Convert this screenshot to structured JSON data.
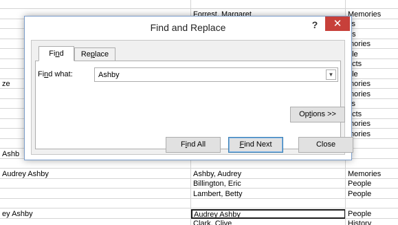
{
  "sheet": {
    "col_a": [
      "",
      "",
      "",
      "",
      "",
      "",
      "",
      "",
      "",
      "",
      "",
      "",
      "",
      "",
      "",
      "",
      "",
      "",
      "",
      "",
      "",
      "",
      ""
    ],
    "col_a_visible": [
      {
        "row": 8,
        "text": "ze"
      },
      {
        "row": 15,
        "text": "Ashb"
      },
      {
        "row": 17,
        "text": "Audrey Ashby"
      },
      {
        "row": 21,
        "text": "ey Ashby"
      }
    ],
    "col_b": [
      "",
      "Forrest, Margaret",
      "",
      "",
      "",
      "",
      "",
      "",
      "",
      "",
      "",
      "",
      "",
      "",
      "",
      "",
      "",
      "Ashby, Audrey",
      "Billington, Eric",
      "Lambert, Betty",
      "",
      "Audrey Ashby",
      "Clark, Clive"
    ],
    "col_c": [
      "",
      "Memories",
      "ks",
      "es",
      "mories",
      "ple",
      "ects",
      "ple",
      "mories",
      "mories",
      "ks",
      "ects",
      "mories",
      "mories",
      "",
      "",
      "",
      "Memories",
      "People",
      "People",
      "",
      "People",
      "History"
    ]
  },
  "dialog": {
    "title": "Find and Replace",
    "help": "?",
    "close": "✕",
    "tab_find": "Find",
    "tab_replace": "Replace",
    "find_label": "Find what:",
    "find_value": "Ashby",
    "options_label": "Options >>",
    "find_all_label": "Find All",
    "find_next_label": "Find Next",
    "close_label": "Close"
  }
}
